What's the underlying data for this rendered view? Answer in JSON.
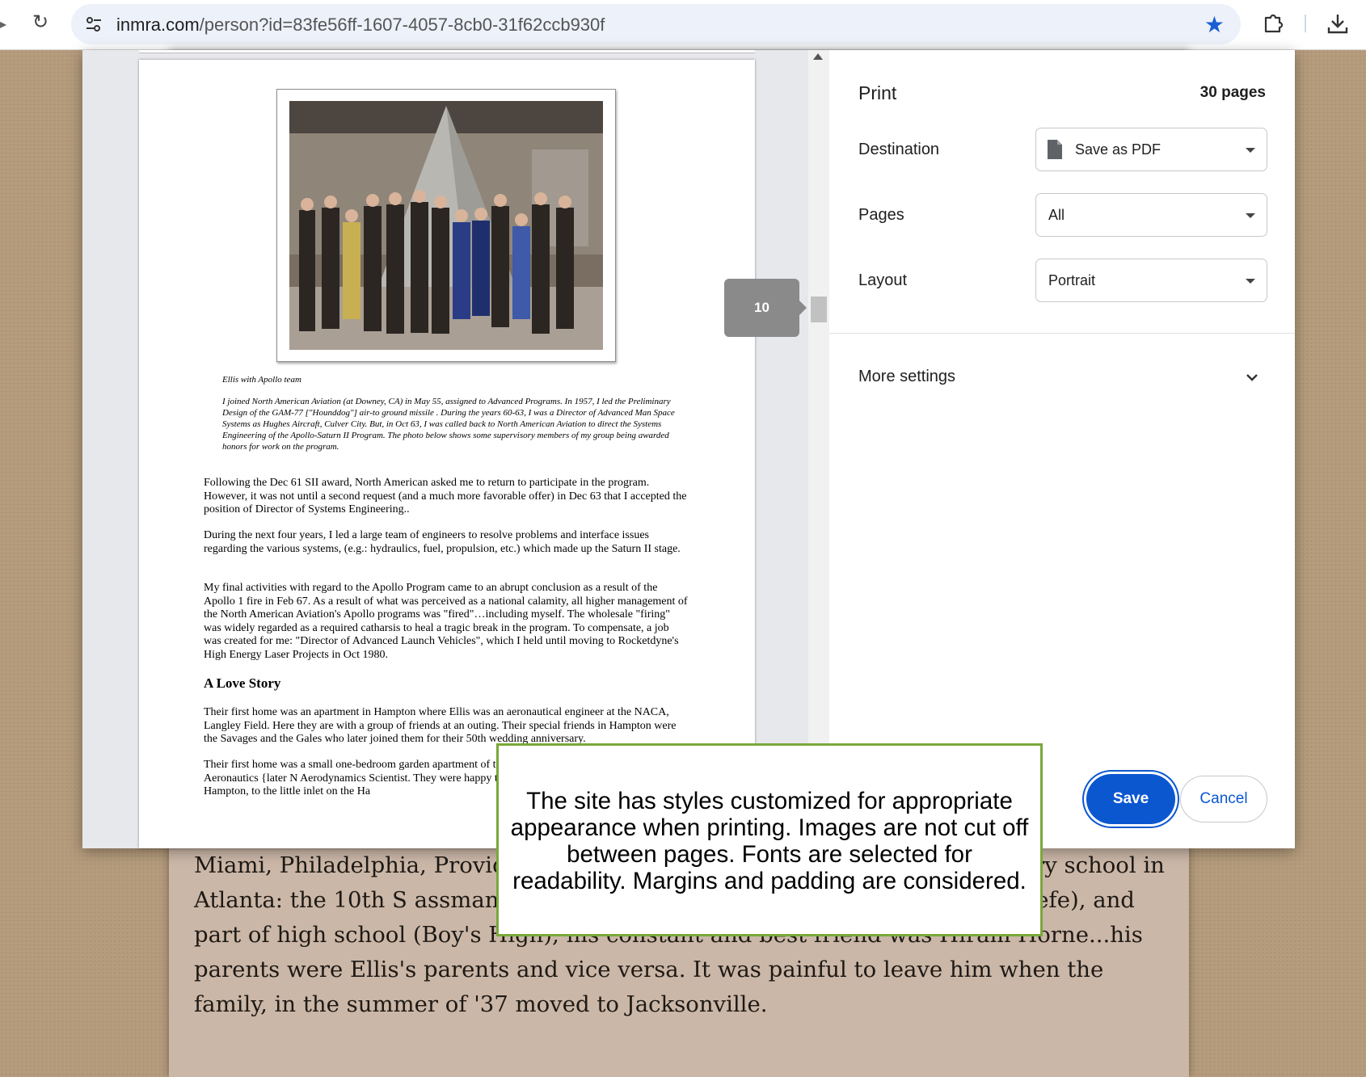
{
  "browser": {
    "url_host": "inmra.com",
    "url_path": "/person?id=83fe56ff-1607-4057-8cb0-31f62ccb930f"
  },
  "print_dialog": {
    "title": "Print",
    "page_count": "30 pages",
    "destination": {
      "label": "Destination",
      "value": "Save as PDF"
    },
    "pages": {
      "label": "Pages",
      "value": "All"
    },
    "layout": {
      "label": "Layout",
      "value": "Portrait"
    },
    "more_settings": "More settings",
    "save_label": "Save",
    "cancel_label": "Cancel",
    "preview_page_number": "10"
  },
  "preview": {
    "caption": "Ellis with Apollo team",
    "intro": "I joined North American Aviation (at Downey, CA) in May 55, assigned to Advanced Programs. In 1957, I led the Preliminary Design of the GAM-77 [\"Hounddog\"] air-to ground missile . During the years 60-63, I was a Director of Advanced Man Space Systems as Hughes Aircraft, Culver City. But, in Oct 63, I was called back to North American Aviation to direct the Systems Engineering of the Apollo-Saturn II Program. The photo below shows some supervisory members of my group being awarded honors for work on the program.",
    "para1": "Following the Dec 61 SII award, North American asked me to return to participate in the program. However, it was not until a second request (and a much more favorable offer) in Dec 63 that I accepted the position of Director of Systems Engineering..",
    "para2": "During the next four years, I led a large team of engineers to resolve problems and interface issues regarding the various systems, (e.g.: hydraulics, fuel, propulsion, etc.) which made up the Saturn II stage.",
    "para3": "My final activities with regard to the Apollo Program came to an abrupt conclusion as a result of the Apollo 1 fire in Feb 67. As a result of what was perceived as a national calamity, all higher management of the North American Aviation's Apollo programs was \"fired\"…including myself. The wholesale \"firing\" was widely regarded as a required catharsis to heal a tragic break in the program. To compensate, a job was created for me: \"Director of Advanced Launch Vehicles\", which I held until moving to Rocketdyne's High Energy Laser Projects in Oct 1980.",
    "subhead": "A Love Story",
    "para5": "Their first home was an apartment in Hampton where Ellis was an aeronautical engineer at the NACA, Langley Field. Here they are with a group of friends at an outing. Their special friends in Hampton were the Savages and the Gales who later joined them for their 50th wedding anniversary.",
    "para6": "Their first home was a small one-bedroom garden apartment of the National Advisory Committee for Aeronautics {later N Aerodynamics Scientist. They were happy there and,without walked: to “downtown” Hampton, to the little inlet on the Ha"
  },
  "background_text": "Miami, Philadelphia, Provid nville. At one time, Ellis and Marjorie lementary school in Atlanta: the 10th S assman\"] All through elementary school, Jr. High (O'Keefe), and part of high school (Boy's High), his constant and best friend was Hiram Horne...his parents were Ellis's parents and vice versa. It was painful to leave him when the family, in the summer of '37 moved to Jacksonville.",
  "annotation": "The site has styles customized for appropriate appearance when printing.  Images are not cut off between pages.  Fonts are selected for readability.  Margins and padding are considered.",
  "icons": {
    "reload": "reload-icon",
    "site_settings": "tune-icon",
    "bookmark": "star-icon",
    "extensions": "puzzle-icon",
    "downloads": "download-icon",
    "pdf": "document-icon",
    "expand": "chevron-down-icon"
  },
  "colors": {
    "accent": "#0b57d0",
    "callout_border": "#7aa83a",
    "bookmark": "#1a5fd1"
  }
}
